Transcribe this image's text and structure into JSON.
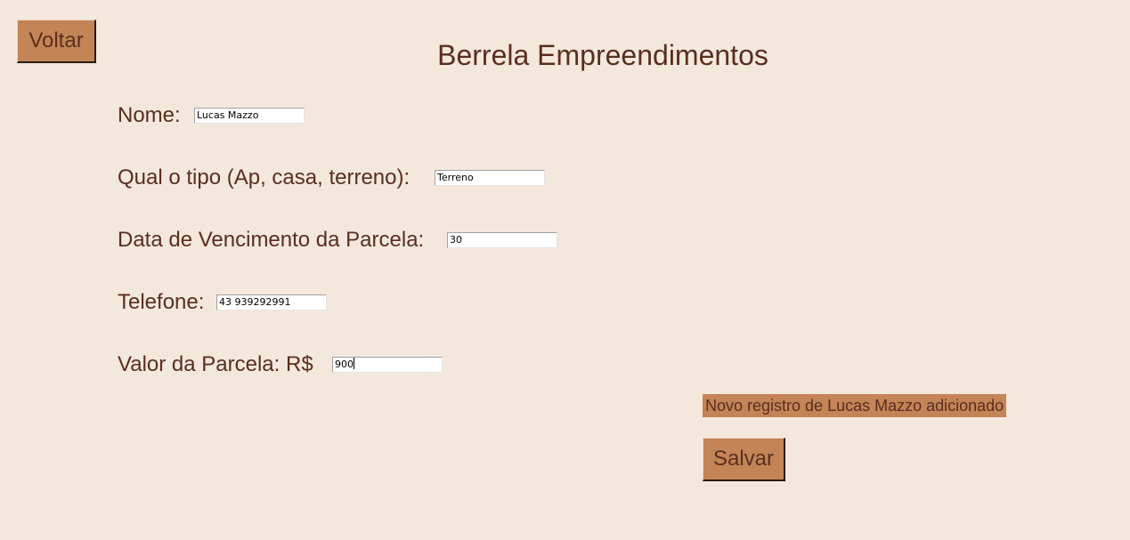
{
  "buttons": {
    "back_label": "Voltar",
    "save_label": "Salvar"
  },
  "title": "Berrela Empreendimentos",
  "form": {
    "name": {
      "label": "Nome:",
      "value": "Lucas Mazzo"
    },
    "type": {
      "label": "Qual o tipo (Ap, casa, terreno):",
      "value": "Terreno"
    },
    "due_date": {
      "label": "Data de Vencimento da Parcela:",
      "value": "30"
    },
    "phone": {
      "label": "Telefone:",
      "value": "43 939292991"
    },
    "amount": {
      "label": "Valor da Parcela: R$",
      "value": "900"
    }
  },
  "status_message": "Novo registro de Lucas Mazzo adicionado",
  "colors": {
    "background": "#f4e8dd",
    "button": "#c38456",
    "text": "#5a2e1e"
  }
}
